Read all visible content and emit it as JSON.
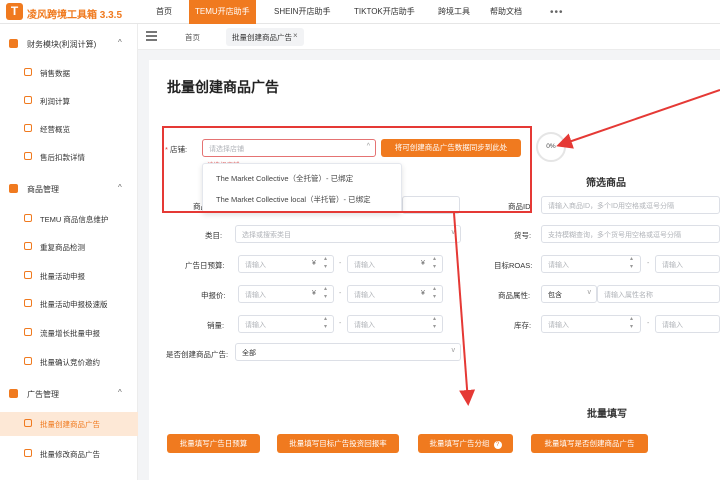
{
  "app": {
    "logo_letter": "T",
    "title": "凌风跨境工具箱 3.3.5"
  },
  "nav": {
    "items": [
      "首页",
      "TEMU开店助手",
      "SHEIN开店助手",
      "TIKTOK开店助手",
      "跨境工具",
      "帮助文档"
    ],
    "more": "•••"
  },
  "sidebar": {
    "groups": [
      {
        "label": "财务模块(利润计算)",
        "items": [
          "销售数据",
          "利润计算",
          "经营概览",
          "售后扣款详情"
        ]
      },
      {
        "label": "商品管理",
        "items": [
          "TEMU 商品信息维护",
          "重复商品检测",
          "批量活动申报",
          "批量活动申报极速版",
          "流量增长批量申报",
          "批量确认竞价邀约"
        ]
      },
      {
        "label": "广告管理",
        "items": [
          "批量创建商品广告",
          "批量修改商品广告"
        ]
      }
    ],
    "active_item": "批量创建商品广告"
  },
  "tabs": {
    "home": "首页",
    "current": "批量创建商品广告",
    "close": "×"
  },
  "page": {
    "title": "批量创建商品广告"
  },
  "form": {
    "store_label": "店铺:",
    "store_placeholder": "请选择店铺",
    "store_error": "请选择店铺",
    "sync_button": "将可创建商品广告数据同步到此处",
    "progress": "0%",
    "store_options": [
      "The Market Collective（全托管）- 已绑定",
      "The Market Collective local（半托管）- 已绑定"
    ],
    "filter_title": "筛选商品",
    "row_label_partial": "商品",
    "category_label": "类目:",
    "category_placeholder": "选择或搜索类目",
    "budget_label": "广告日预算:",
    "price_label": "申报价:",
    "sales_label": "销量:",
    "created_label": "是否创建商品广告:",
    "created_value": "全部",
    "input_placeholder": "请输入",
    "yen": "¥",
    "dash": "-",
    "product_id_label": "商品ID:",
    "product_id_placeholder": "请输入商品ID，多个ID用空格或逗号分隔",
    "sku_label": "货号:",
    "sku_placeholder": "支持模糊查询，多个货号用空格或逗号分隔",
    "roas_label": "目标ROAS:",
    "attr_label": "商品属性:",
    "attr_mode": "包含",
    "attr_placeholder": "请输入属性名称",
    "stock_label": "库存:"
  },
  "batch": {
    "title": "批量填写",
    "buttons": [
      "批量填写广告日预算",
      "批量填写目标广告投资回报率",
      "批量填写广告分组",
      "批量填写是否创建商品广告"
    ],
    "help_icon": "?"
  },
  "colors": {
    "accent": "#f07a1f",
    "annotation": "#e53935"
  }
}
